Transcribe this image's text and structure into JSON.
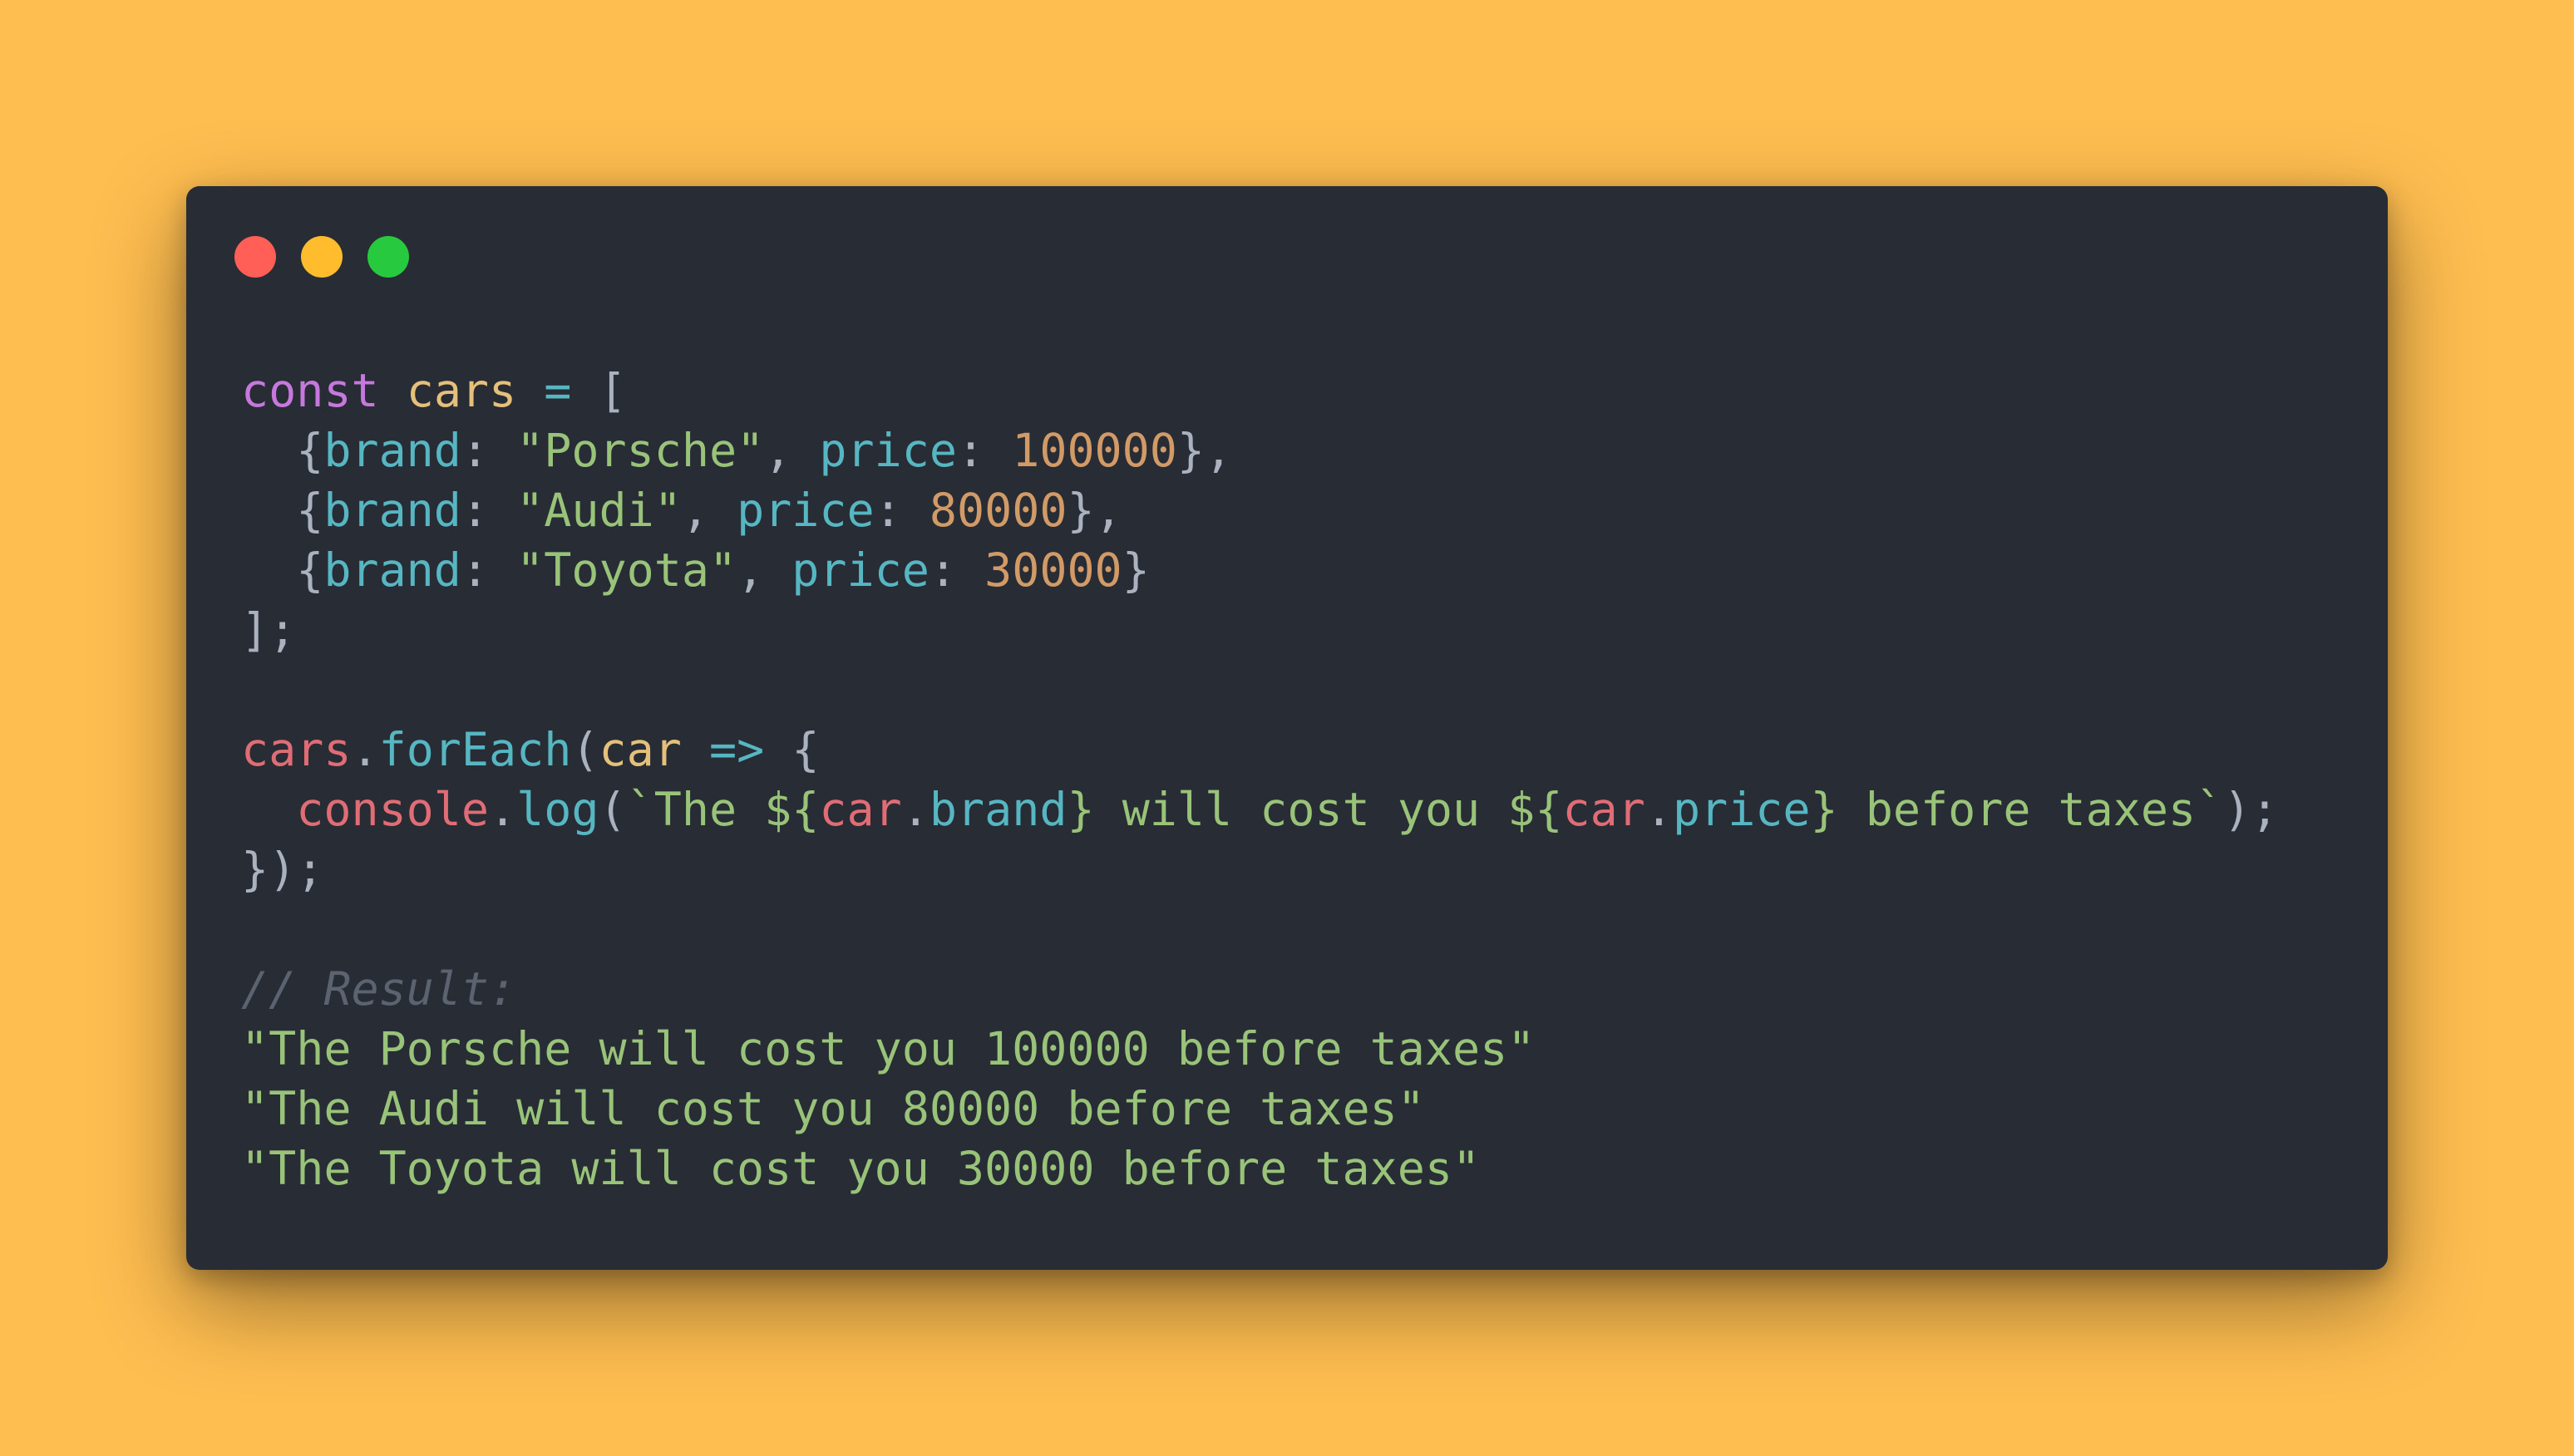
{
  "colors": {
    "background": "#FFBE50",
    "window": "#282C34",
    "dot_close": "#FF5F56",
    "dot_minimize": "#FFBD2E",
    "dot_zoom": "#27C93F",
    "keyword": "#C678DD",
    "variable": "#E5C07B",
    "operator": "#56B6C2",
    "punctuation": "#ABB2BF",
    "property": "#56B6C2",
    "string": "#98C379",
    "number": "#D19A66",
    "object": "#E06C75",
    "comment": "#5C6370"
  },
  "window": {
    "controls": [
      "close-dot",
      "minimize-dot",
      "zoom-dot"
    ]
  },
  "code_lines": [
    [
      {
        "t": "const",
        "c": "keyword"
      },
      {
        "t": " ",
        "c": "punctuation"
      },
      {
        "t": "cars",
        "c": "variable"
      },
      {
        "t": " ",
        "c": "punctuation"
      },
      {
        "t": "=",
        "c": "operator"
      },
      {
        "t": " [",
        "c": "punctuation"
      }
    ],
    [
      {
        "t": "  {",
        "c": "punctuation"
      },
      {
        "t": "brand",
        "c": "property"
      },
      {
        "t": ": ",
        "c": "punctuation"
      },
      {
        "t": "\"Porsche\"",
        "c": "string"
      },
      {
        "t": ", ",
        "c": "punctuation"
      },
      {
        "t": "price",
        "c": "property"
      },
      {
        "t": ": ",
        "c": "punctuation"
      },
      {
        "t": "100000",
        "c": "number"
      },
      {
        "t": "},",
        "c": "punctuation"
      }
    ],
    [
      {
        "t": "  {",
        "c": "punctuation"
      },
      {
        "t": "brand",
        "c": "property"
      },
      {
        "t": ": ",
        "c": "punctuation"
      },
      {
        "t": "\"Audi\"",
        "c": "string"
      },
      {
        "t": ", ",
        "c": "punctuation"
      },
      {
        "t": "price",
        "c": "property"
      },
      {
        "t": ": ",
        "c": "punctuation"
      },
      {
        "t": "80000",
        "c": "number"
      },
      {
        "t": "},",
        "c": "punctuation"
      }
    ],
    [
      {
        "t": "  {",
        "c": "punctuation"
      },
      {
        "t": "brand",
        "c": "property"
      },
      {
        "t": ": ",
        "c": "punctuation"
      },
      {
        "t": "\"Toyota\"",
        "c": "string"
      },
      {
        "t": ", ",
        "c": "punctuation"
      },
      {
        "t": "price",
        "c": "property"
      },
      {
        "t": ": ",
        "c": "punctuation"
      },
      {
        "t": "30000",
        "c": "number"
      },
      {
        "t": "}",
        "c": "punctuation"
      }
    ],
    [
      {
        "t": "];",
        "c": "punctuation"
      }
    ],
    [],
    [
      {
        "t": "cars",
        "c": "object"
      },
      {
        "t": ".",
        "c": "punctuation"
      },
      {
        "t": "forEach",
        "c": "property"
      },
      {
        "t": "(",
        "c": "punctuation"
      },
      {
        "t": "car",
        "c": "variable"
      },
      {
        "t": " ",
        "c": "punctuation"
      },
      {
        "t": "=>",
        "c": "operator"
      },
      {
        "t": " {",
        "c": "punctuation"
      }
    ],
    [
      {
        "t": "  ",
        "c": "punctuation"
      },
      {
        "t": "console",
        "c": "object"
      },
      {
        "t": ".",
        "c": "punctuation"
      },
      {
        "t": "log",
        "c": "property"
      },
      {
        "t": "(",
        "c": "punctuation"
      },
      {
        "t": "`The ${",
        "c": "string"
      },
      {
        "t": "car",
        "c": "object"
      },
      {
        "t": ".",
        "c": "punctuation"
      },
      {
        "t": "brand",
        "c": "property"
      },
      {
        "t": "} will cost you ${",
        "c": "string"
      },
      {
        "t": "car",
        "c": "object"
      },
      {
        "t": ".",
        "c": "punctuation"
      },
      {
        "t": "price",
        "c": "property"
      },
      {
        "t": "} before taxes`",
        "c": "string"
      },
      {
        "t": ");",
        "c": "punctuation"
      }
    ],
    [
      {
        "t": "});",
        "c": "punctuation"
      }
    ],
    [],
    [
      {
        "t": "// Result:",
        "c": "comment"
      }
    ],
    [
      {
        "t": "\"The Porsche will cost you 100000 before taxes\"",
        "c": "string"
      }
    ],
    [
      {
        "t": "\"The Audi will cost you 80000 before taxes\"",
        "c": "string"
      }
    ],
    [
      {
        "t": "\"The Toyota will cost you 30000 before taxes\"",
        "c": "string"
      }
    ]
  ]
}
